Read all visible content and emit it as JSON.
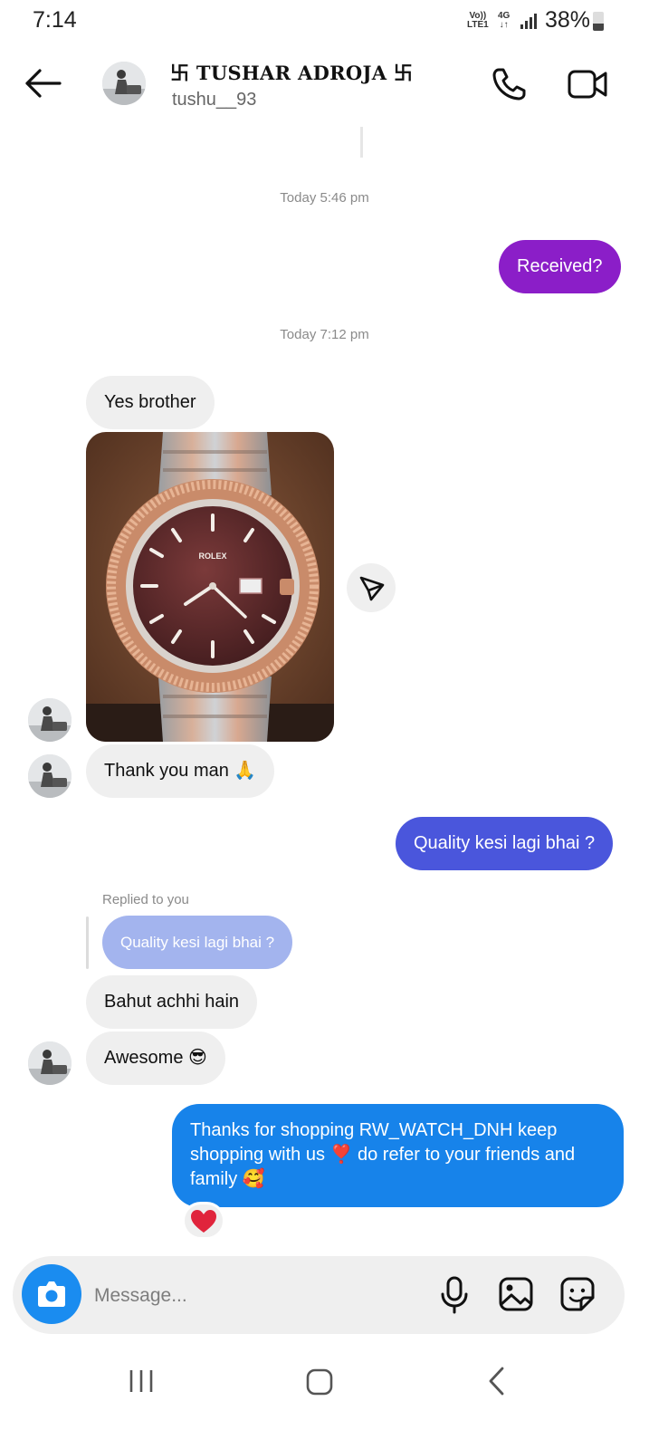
{
  "status_bar": {
    "time": "7:14",
    "network_line1": "Vo))",
    "network_line2": "LTE1",
    "data_type": "4G",
    "battery_percent": "38%"
  },
  "header": {
    "display_name": "卐 TUSHAR ADROJA 卐",
    "username": "tushu__93",
    "back_icon": "arrow-left-icon",
    "call_icon": "phone-icon",
    "video_icon": "video-camera-icon"
  },
  "messages": {
    "timestamp_1": "Today 5:46 pm",
    "received_q": "Received?",
    "timestamp_2": "Today 7:12 pm",
    "yes_brother": "Yes brother",
    "thank_you": "Thank you man 🙏",
    "quality_q": "Quality kesi lagi bhai ?",
    "replied_label": "Replied to you",
    "reply_quote": "Quality kesi lagi bhai ?",
    "bahut_achhi": "Bahut achhi hain",
    "awesome": "Awesome 😎",
    "thanks_line1": "Thanks for shopping RW_WATCH_DNH keep",
    "thanks_line2": "shopping with us ❣️ do refer to your friends and",
    "thanks_line3": "family 🥰",
    "reaction": "❤️"
  },
  "composer": {
    "placeholder": "Message...",
    "camera_icon": "camera-icon",
    "mic_icon": "microphone-icon",
    "gallery_icon": "gallery-icon",
    "sticker_icon": "sticker-icon"
  },
  "colors": {
    "bubble_purple": "#8b1ec8",
    "bubble_indigo": "#4a56dc",
    "bubble_blue": "#1783ea",
    "bubble_incoming": "#efefef",
    "reply_quote": "#a3b4ee",
    "camera_blue": "#1a8cf0"
  }
}
